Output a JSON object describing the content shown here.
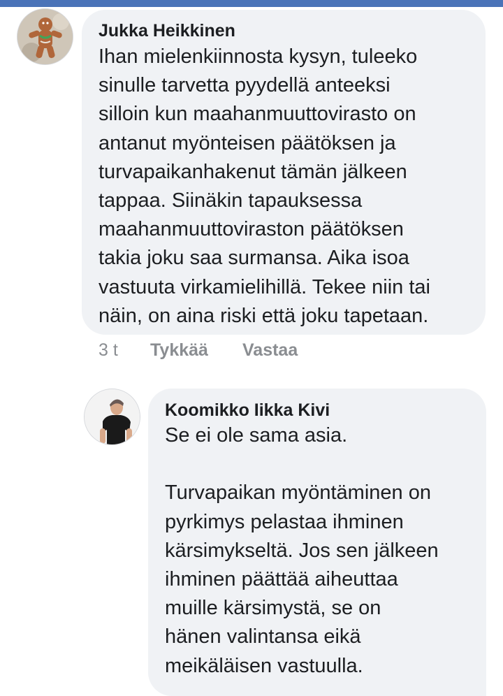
{
  "comments": [
    {
      "author": "Jukka Heikkinen",
      "avatar_icon": "gingerbread-figure-avatar",
      "text": "Ihan mielenkiinnosta kysyn, tuleeko\nsinulle tarvetta pyydellä anteeksi\nsilloin kun maahanmuuttovirasto on\nantanut myönteisen päätöksen ja\nturvapaikanhakenut tämän jälkeen\ntappaa. Siinäkin tapauksessa\nmaahanmuuttoviraston päätöksen\ntakia joku saa surmansa. Aika isoa\nvastuuta virkamielihillä. Tekee niin tai\nnäin, on aina riski että joku tapetaan.",
      "time": "3 t",
      "like_label": "Tykkää",
      "reply_label": "Vastaa"
    },
    {
      "author": "Koomikko Iikka Kivi",
      "avatar_icon": "person-photo-avatar",
      "text": "Se ei ole sama asia.\n\nTurvapaikan myöntäminen on\npyrkimys pelastaa ihminen\nkärsimykseltä. Jos sen jälkeen\nihminen päättää aiheuttaa\nmuille kärsimystä, se on\nhänen valintansa eikä\nmeikäläisen vastuulla."
    }
  ],
  "colors": {
    "top_strip": "#4a73b8",
    "bubble": "#f0f2f5",
    "text": "#1c1e21",
    "secondary": "#8a8d91"
  }
}
